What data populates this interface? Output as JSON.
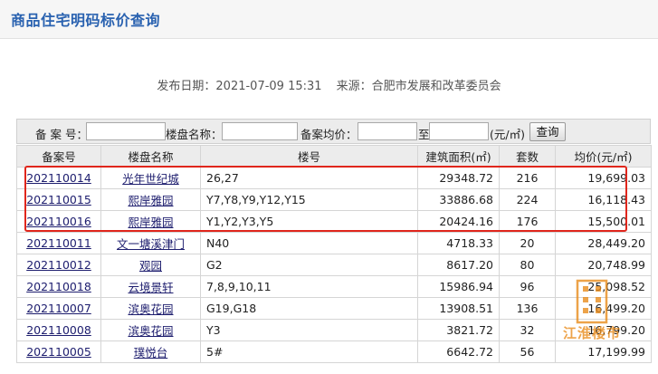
{
  "page": {
    "title": "商品住宅明码标价查询",
    "publish_label": "发布日期：",
    "publish_date": "2021-07-09 15:31",
    "source_label": "来源：",
    "source": "合肥市发展和改革委员会"
  },
  "search": {
    "code_label": "备 案 号：",
    "name_label": "楼盘名称：",
    "price_label": "备案均价：",
    "to_label": "至",
    "unit_label": "(元/㎡)",
    "button_label": "查询",
    "code_value": "",
    "name_value": "",
    "price_from_value": "",
    "price_to_value": ""
  },
  "table": {
    "columns": [
      "备案号",
      "楼盘名称",
      "楼号",
      "建筑面积(㎡)",
      "套数",
      "均价(元/㎡)"
    ],
    "rows": [
      {
        "code": "202110014",
        "name": "光年世纪城",
        "buildings": "26,27",
        "area": "29348.72",
        "units": "216",
        "price": "19,699.03"
      },
      {
        "code": "202110015",
        "name": "熙岸雅园",
        "buildings": "Y7,Y8,Y9,Y12,Y15",
        "area": "33886.68",
        "units": "224",
        "price": "16,118.43"
      },
      {
        "code": "202110016",
        "name": "熙岸雅园",
        "buildings": "Y1,Y2,Y3,Y5",
        "area": "20424.16",
        "units": "176",
        "price": "15,500.01"
      },
      {
        "code": "202110011",
        "name": "文一塘溪津门",
        "buildings": "N40",
        "area": "4718.33",
        "units": "20",
        "price": "28,449.20"
      },
      {
        "code": "202110012",
        "name": "观园",
        "buildings": "G2",
        "area": "8617.20",
        "units": "80",
        "price": "20,748.99"
      },
      {
        "code": "202110018",
        "name": "云境景轩",
        "buildings": "7,8,9,10,11",
        "area": "15986.94",
        "units": "96",
        "price": "25,098.52"
      },
      {
        "code": "202110007",
        "name": "滨奥花园",
        "buildings": "G19,G18",
        "area": "13908.51",
        "units": "136",
        "price": "16,499.20"
      },
      {
        "code": "202110008",
        "name": "滨奥花园",
        "buildings": "Y3",
        "area": "3821.72",
        "units": "32",
        "price": "16,799.20"
      },
      {
        "code": "202110005",
        "name": "璞悦台",
        "buildings": "5#",
        "area": "6642.72",
        "units": "56",
        "price": "17,199.99"
      }
    ]
  },
  "watermark": {
    "text": "江淮楼市"
  },
  "colors": {
    "title": "#2a62b0",
    "link": "#1d1d6e",
    "highlight": "#e0261c",
    "watermark": "#e98a17"
  }
}
